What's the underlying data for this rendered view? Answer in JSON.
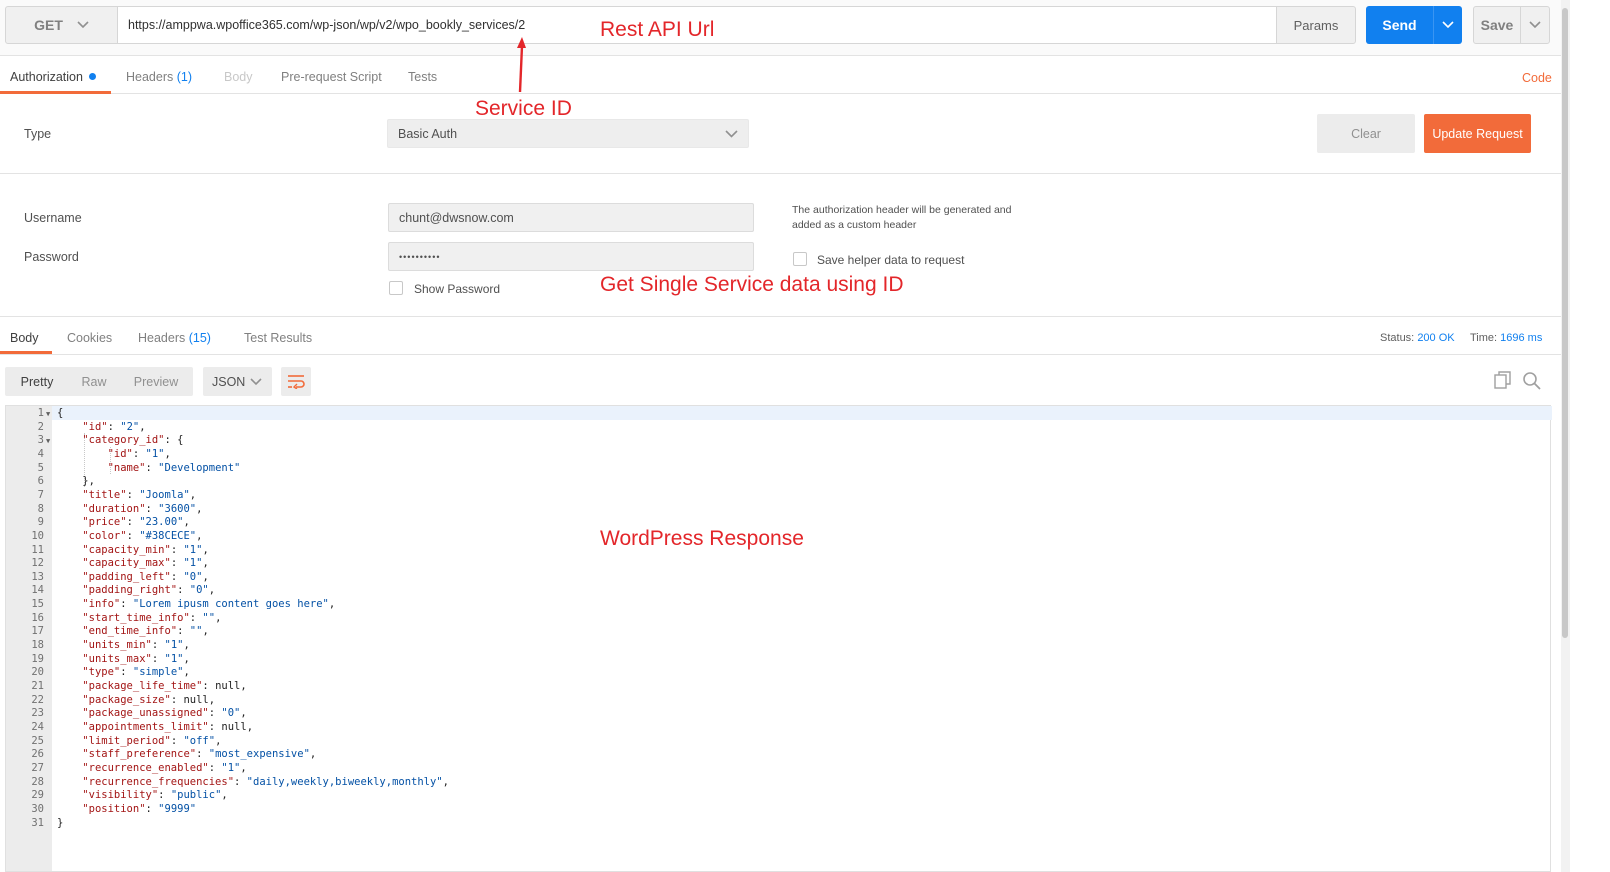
{
  "request": {
    "method": "GET",
    "url": "https://amppwa.wpoffice365.com/wp-json/wp/v2/wpo_bookly_services/2",
    "params_label": "Params",
    "send_label": "Send",
    "save_label": "Save"
  },
  "request_tabs": {
    "authorization": "Authorization",
    "headers": "Headers",
    "headers_count": "(1)",
    "body": "Body",
    "prerequest": "Pre-request Script",
    "tests": "Tests",
    "code": "Code"
  },
  "auth": {
    "type_label": "Type",
    "type_value": "Basic Auth",
    "clear_label": "Clear",
    "update_label": "Update Request",
    "username_label": "Username",
    "username_value": "chunt@dwsnow.com",
    "password_label": "Password",
    "password_value": "••••••••••",
    "info_line1": "The authorization header will be generated and",
    "info_line2": "added as a custom header",
    "save_helper": "Save helper data to request",
    "show_password": "Show Password"
  },
  "annotations": {
    "rest_api_url": "Rest API Url",
    "service_id": "Service ID",
    "get_single": "Get Single Service data using ID",
    "wp_response": "WordPress Response"
  },
  "response_tabs": {
    "body": "Body",
    "cookies": "Cookies",
    "headers": "Headers",
    "headers_count": "(15)",
    "test_results": "Test Results",
    "status_label": "Status:",
    "status_value": "200 OK",
    "time_label": "Time:",
    "time_value": "1696 ms"
  },
  "viewer": {
    "pretty": "Pretty",
    "raw": "Raw",
    "preview": "Preview",
    "format": "JSON"
  },
  "code_lines": [
    {
      "n": "1",
      "fold": true,
      "indent": 0,
      "key": "",
      "val": "",
      "raw": "{"
    },
    {
      "n": "2",
      "indent": 1,
      "key": "\"id\"",
      "val": "\"2\"",
      "tail": ","
    },
    {
      "n": "3",
      "fold": true,
      "indent": 1,
      "key": "\"category_id\"",
      "val": "",
      "tail": "{"
    },
    {
      "n": "4",
      "indent": 2,
      "key": "\"id\"",
      "val": "\"1\"",
      "tail": ","
    },
    {
      "n": "5",
      "indent": 2,
      "key": "\"name\"",
      "val": "\"Development\"",
      "tail": ""
    },
    {
      "n": "6",
      "indent": 1,
      "raw": "},"
    },
    {
      "n": "7",
      "indent": 1,
      "key": "\"title\"",
      "val": "\"Joomla\"",
      "tail": ","
    },
    {
      "n": "8",
      "indent": 1,
      "key": "\"duration\"",
      "val": "\"3600\"",
      "tail": ","
    },
    {
      "n": "9",
      "indent": 1,
      "key": "\"price\"",
      "val": "\"23.00\"",
      "tail": ","
    },
    {
      "n": "10",
      "indent": 1,
      "key": "\"color\"",
      "val": "\"#38CECE\"",
      "tail": ","
    },
    {
      "n": "11",
      "indent": 1,
      "key": "\"capacity_min\"",
      "val": "\"1\"",
      "tail": ","
    },
    {
      "n": "12",
      "indent": 1,
      "key": "\"capacity_max\"",
      "val": "\"1\"",
      "tail": ","
    },
    {
      "n": "13",
      "indent": 1,
      "key": "\"padding_left\"",
      "val": "\"0\"",
      "tail": ","
    },
    {
      "n": "14",
      "indent": 1,
      "key": "\"padding_right\"",
      "val": "\"0\"",
      "tail": ","
    },
    {
      "n": "15",
      "indent": 1,
      "key": "\"info\"",
      "val": "\"Lorem ipusm content goes here\"",
      "tail": ","
    },
    {
      "n": "16",
      "indent": 1,
      "key": "\"start_time_info\"",
      "val": "\"\"",
      "tail": ","
    },
    {
      "n": "17",
      "indent": 1,
      "key": "\"end_time_info\"",
      "val": "\"\"",
      "tail": ","
    },
    {
      "n": "18",
      "indent": 1,
      "key": "\"units_min\"",
      "val": "\"1\"",
      "tail": ","
    },
    {
      "n": "19",
      "indent": 1,
      "key": "\"units_max\"",
      "val": "\"1\"",
      "tail": ","
    },
    {
      "n": "20",
      "indent": 1,
      "key": "\"type\"",
      "val": "\"simple\"",
      "tail": ","
    },
    {
      "n": "21",
      "indent": 1,
      "key": "\"package_life_time\"",
      "plain": "null",
      "tail": ","
    },
    {
      "n": "22",
      "indent": 1,
      "key": "\"package_size\"",
      "plain": "null",
      "tail": ","
    },
    {
      "n": "23",
      "indent": 1,
      "key": "\"package_unassigned\"",
      "val": "\"0\"",
      "tail": ","
    },
    {
      "n": "24",
      "indent": 1,
      "key": "\"appointments_limit\"",
      "plain": "null",
      "tail": ","
    },
    {
      "n": "25",
      "indent": 1,
      "key": "\"limit_period\"",
      "val": "\"off\"",
      "tail": ","
    },
    {
      "n": "26",
      "indent": 1,
      "key": "\"staff_preference\"",
      "val": "\"most_expensive\"",
      "tail": ","
    },
    {
      "n": "27",
      "indent": 1,
      "key": "\"recurrence_enabled\"",
      "val": "\"1\"",
      "tail": ","
    },
    {
      "n": "28",
      "indent": 1,
      "key": "\"recurrence_frequencies\"",
      "val": "\"daily,weekly,biweekly,monthly\"",
      "tail": ","
    },
    {
      "n": "29",
      "indent": 1,
      "key": "\"visibility\"",
      "val": "\"public\"",
      "tail": ","
    },
    {
      "n": "30",
      "indent": 1,
      "key": "\"position\"",
      "val": "\"9999\"",
      "tail": ""
    },
    {
      "n": "31",
      "indent": 0,
      "raw": "}"
    }
  ],
  "colors": {
    "accent_orange": "#f26b3a",
    "send_blue": "#1180ef",
    "annotation_red": "#e3262a"
  }
}
